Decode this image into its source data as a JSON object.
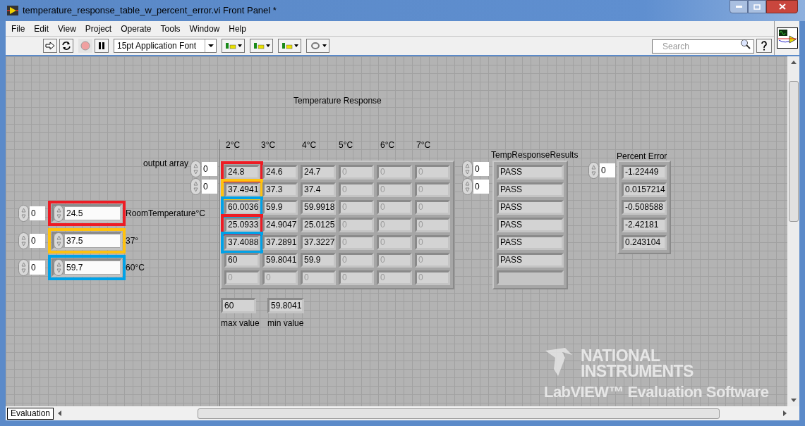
{
  "window": {
    "title": "temperature_response_table_w_percent_error.vi Front Panel *"
  },
  "menu": [
    "File",
    "Edit",
    "View",
    "Project",
    "Operate",
    "Tools",
    "Window",
    "Help"
  ],
  "toolbar": {
    "font": "15pt Application Font",
    "search": {
      "placeholder": "Search"
    }
  },
  "panel": {
    "title": "Temperature Response",
    "inputs": [
      {
        "index": "0",
        "value": "24.5",
        "label": "RoomTemperature°C",
        "color": "#ed1c24"
      },
      {
        "index": "0",
        "value": "37.5",
        "label": "37°",
        "color": "#ffc20e"
      },
      {
        "index": "0",
        "value": "59.7",
        "label": "60°C",
        "color": "#00a2e8"
      }
    ],
    "output_array": {
      "label": "output array",
      "indices": [
        "0",
        "0"
      ],
      "columns": [
        "2°C",
        "3°C",
        "4°C",
        "5°C",
        "6°C",
        "7°C"
      ],
      "rows": [
        [
          {
            "text": "24.8",
            "disabled": false,
            "color": "#ed1c24"
          },
          {
            "text": "24.6",
            "disabled": false
          },
          {
            "text": "24.7",
            "disabled": false
          },
          {
            "text": "0",
            "disabled": true
          },
          {
            "text": "0",
            "disabled": true
          },
          {
            "text": "0",
            "disabled": true
          }
        ],
        [
          {
            "text": "37.4941",
            "disabled": false,
            "color": "#ffc20e"
          },
          {
            "text": "37.3",
            "disabled": false
          },
          {
            "text": "37.4",
            "disabled": false
          },
          {
            "text": "0",
            "disabled": true
          },
          {
            "text": "0",
            "disabled": true
          },
          {
            "text": "0",
            "disabled": true
          }
        ],
        [
          {
            "text": "60.0036",
            "disabled": false,
            "color": "#00a2e8"
          },
          {
            "text": "59.9",
            "disabled": false
          },
          {
            "text": "59.9918",
            "disabled": false
          },
          {
            "text": "0",
            "disabled": true
          },
          {
            "text": "0",
            "disabled": true
          },
          {
            "text": "0",
            "disabled": true
          }
        ],
        [
          {
            "text": "25.0933",
            "disabled": false,
            "color": "#ed1c24"
          },
          {
            "text": "24.9047",
            "disabled": false
          },
          {
            "text": "25.0125",
            "disabled": false
          },
          {
            "text": "0",
            "disabled": true
          },
          {
            "text": "0",
            "disabled": true
          },
          {
            "text": "0",
            "disabled": true
          }
        ],
        [
          {
            "text": "37.4088",
            "disabled": false,
            "color": "#00a2e8"
          },
          {
            "text": "37.2891",
            "disabled": false
          },
          {
            "text": "37.3227",
            "disabled": false
          },
          {
            "text": "0",
            "disabled": true
          },
          {
            "text": "0",
            "disabled": true
          },
          {
            "text": "0",
            "disabled": true
          }
        ],
        [
          {
            "text": "60",
            "disabled": false
          },
          {
            "text": "59.8041",
            "disabled": false
          },
          {
            "text": "59.9",
            "disabled": false
          },
          {
            "text": "0",
            "disabled": true
          },
          {
            "text": "0",
            "disabled": true
          },
          {
            "text": "0",
            "disabled": true
          }
        ],
        [
          {
            "text": "0",
            "disabled": true
          },
          {
            "text": "0",
            "disabled": true
          },
          {
            "text": "0",
            "disabled": true
          },
          {
            "text": "0",
            "disabled": true
          },
          {
            "text": "0",
            "disabled": true
          },
          {
            "text": "0",
            "disabled": true
          }
        ]
      ]
    },
    "max": {
      "value": "60",
      "label": "max value"
    },
    "min": {
      "value": "59.8041",
      "label": "min value"
    },
    "results": {
      "label": "TempResponseResults",
      "indices": [
        "0",
        "0"
      ],
      "items": [
        "PASS",
        "PASS",
        "PASS",
        "PASS",
        "PASS",
        "PASS"
      ]
    },
    "percent_error": {
      "label": "Percent Error",
      "index": "0",
      "items": [
        "-1.22449",
        "0.0157214",
        "-0.508588",
        "-2.42181",
        "0.243104"
      ]
    }
  },
  "watermark": {
    "brand": [
      "NATIONAL",
      "INSTRUMENTS"
    ],
    "product": "LabVIEW™ Evaluation Software"
  },
  "status_bar": {
    "tab": "Evaluation"
  }
}
